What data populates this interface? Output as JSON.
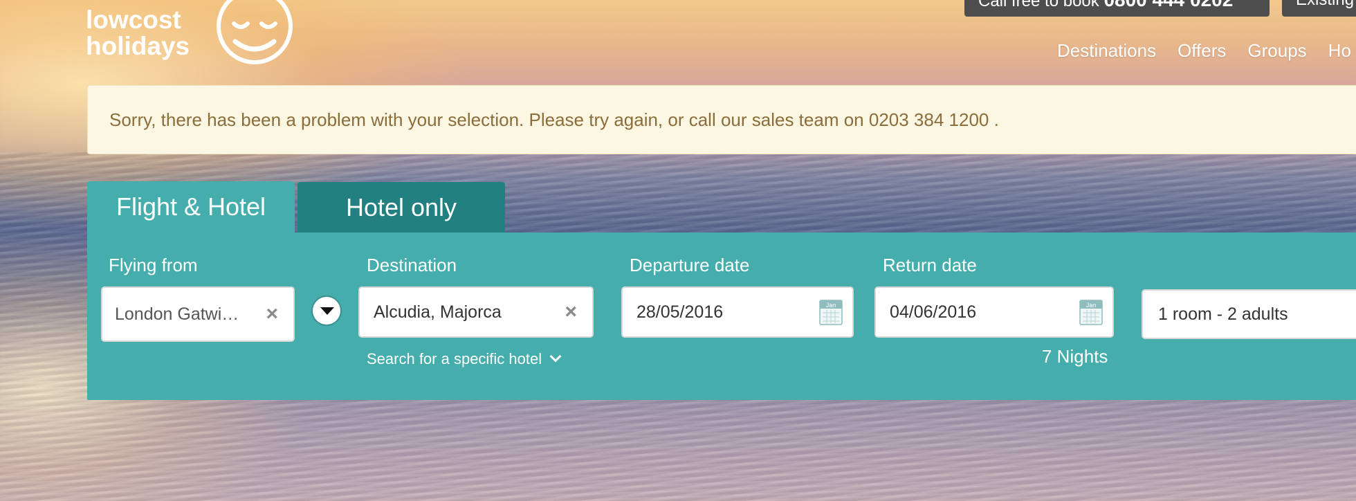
{
  "logo": {
    "line1": "lowcost",
    "line2": "holidays",
    "icon": "smiley-face-icon"
  },
  "header": {
    "call_label": "Call free to book",
    "call_number": "0800 444 0202",
    "existing_label": "Existing"
  },
  "nav": {
    "items": [
      "Destinations",
      "Offers",
      "Groups",
      "Ho"
    ]
  },
  "alert": {
    "text": "Sorry, there has been a problem with your selection. Please try again, or call our sales team on 0203 384 1200 ."
  },
  "tabs": [
    {
      "label": "Flight & Hotel",
      "active": true
    },
    {
      "label": "Hotel only",
      "active": false
    }
  ],
  "search": {
    "flying_from_label": "Flying from",
    "flying_from_value": "London Gatwi…",
    "destination_label": "Destination",
    "destination_value": "Alcudia, Majorca",
    "specific_hotel_link": "Search for a specific hotel",
    "departure_label": "Departure date",
    "departure_value": "28/05/2016",
    "return_label": "Return date",
    "return_value": "04/06/2016",
    "nights": "7 Nights",
    "rooms_value": "1 room - 2 adults",
    "calendar_icon_text": "Jan"
  },
  "colors": {
    "panel": "#46adad",
    "tab_inactive": "#228080",
    "alert_bg": "#fcf7e3",
    "alert_text": "#8a6d3b"
  }
}
